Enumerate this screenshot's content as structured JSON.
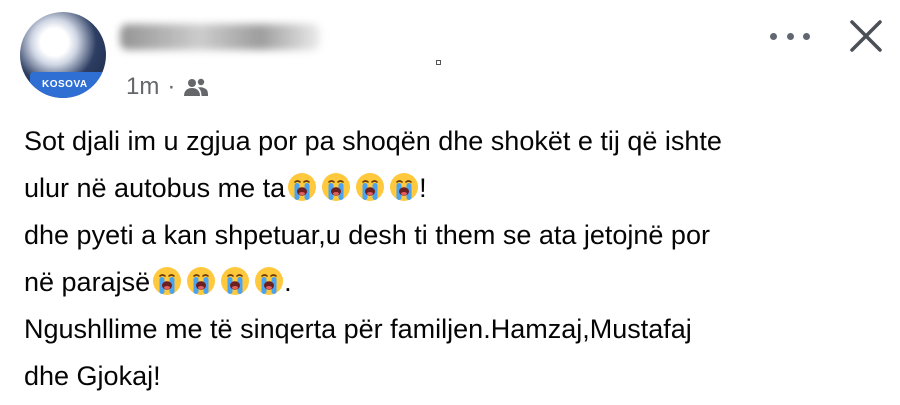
{
  "post": {
    "time": "1m",
    "separator": "·",
    "audience_icon": "friends-icon",
    "lines": [
      {
        "text": "Sot djali im u zgjua por pa shoqën dhe shokët e tij që ishte",
        "after": "",
        "emoji_count": 0
      },
      {
        "text": "ulur në autobus me ta",
        "after": "!",
        "emoji_count": 4
      },
      {
        "text": "dhe pyeti a kan shpetuar,u desh ti them se ata jetojnë por",
        "after": "",
        "emoji_count": 0
      },
      {
        "text": "në parajsë",
        "after": ".",
        "emoji_count": 4
      },
      {
        "text": " Ngushllime me të sinqerta për familjen.Hamzaj,Mustafaj",
        "after": "",
        "emoji_count": 0
      },
      {
        "text": "dhe Gjokaj!",
        "after": "",
        "emoji_count": 0
      }
    ],
    "emoji": "loudly-crying-face-icon"
  },
  "avatar": {
    "badge_text": "KOSOVA"
  },
  "icons": {
    "more": "more-options-icon",
    "close": "close-icon"
  },
  "colors": {
    "meta_gray": "#65676b",
    "emoji_yellow": "#ffc83d",
    "tear_blue": "#4aa3f0"
  }
}
